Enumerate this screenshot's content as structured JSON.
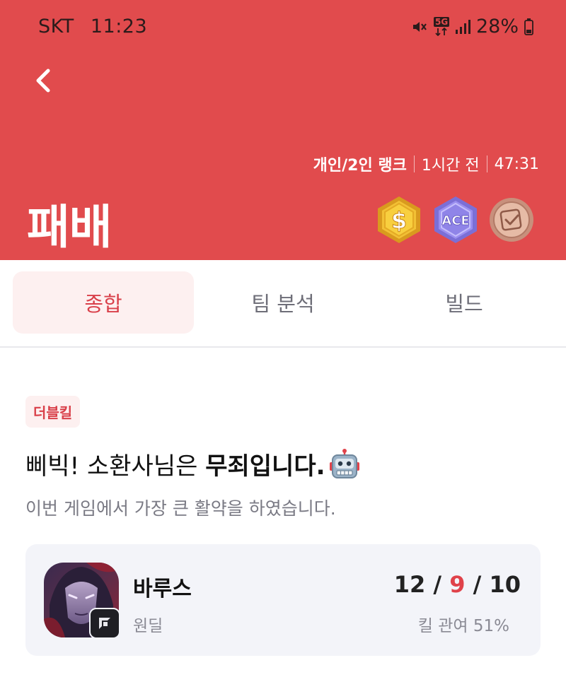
{
  "status_bar": {
    "carrier": "SKT",
    "time": "11:23",
    "network": "5G",
    "battery": "28%"
  },
  "header": {
    "queue_type": "개인/2인 랭크",
    "time_ago": "1시간 전",
    "duration": "47:31",
    "result": "패배",
    "bg_color": "#e14b4d",
    "badges": [
      "gold-coin-icon",
      "ace-icon",
      "bronze-badge-icon"
    ],
    "badge_ace_text": "ACE"
  },
  "tabs": [
    {
      "label": "종합",
      "active": true
    },
    {
      "label": "팀 분석",
      "active": false
    },
    {
      "label": "빌드",
      "active": false
    }
  ],
  "summary": {
    "tag": "더블킬",
    "headline_prefix": "삐빅! 소환사님은 ",
    "headline_bold": "무죄입니다.",
    "subtext": "이번 게임에서 가장 큰 활약을 하였습니다."
  },
  "champion": {
    "name": "바루스",
    "role": "원딜",
    "kills": "12",
    "deaths": "9",
    "assists": "10",
    "kda_sep": " / ",
    "kill_participation": "킬 관여 51%"
  }
}
